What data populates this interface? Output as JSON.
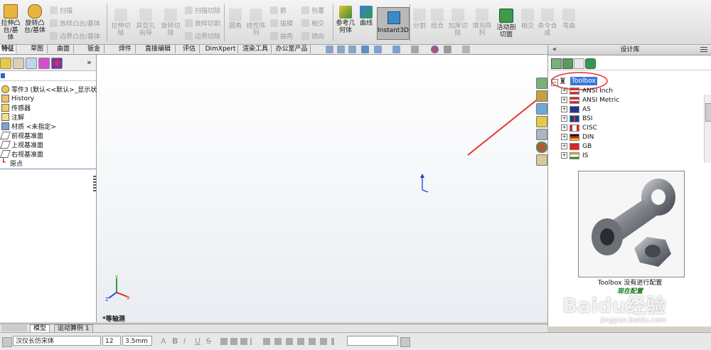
{
  "ribbon": {
    "big_buttons": [
      {
        "label1": "拉伸凸",
        "label2": "台/基体"
      },
      {
        "label1": "旋转凸",
        "label2": "台/基体"
      }
    ],
    "small_group1": [
      "扫描",
      "放样凸台/基体",
      "边界凸台/基体"
    ],
    "cut_buttons": [
      {
        "label1": "拉伸切",
        "label2": "除"
      },
      {
        "label1": "异型孔",
        "label2": "向导"
      },
      {
        "label1": "旋转切",
        "label2": "除"
      }
    ],
    "small_group2": [
      "扫描切除",
      "放样切割",
      "边界切除"
    ],
    "feature_buttons": [
      {
        "label1": "圆角",
        "label2": ""
      },
      {
        "label1": "线性阵",
        "label2": "列"
      }
    ],
    "small_group3": [
      "筋",
      "拔模",
      "抽壳"
    ],
    "small_group4": [
      "包覆",
      "相交",
      "镜向"
    ],
    "ref_geometry": {
      "label1": "参考几",
      "label2": "何体"
    },
    "curves": {
      "label1": "曲线",
      "label2": ""
    },
    "instant3d": "Instant3D",
    "right_buttons": [
      {
        "label1": "分割",
        "label2": ""
      },
      {
        "label1": "组合",
        "label2": ""
      },
      {
        "label1": "加厚切",
        "label2": "除"
      },
      {
        "label1": "填充阵",
        "label2": "列"
      },
      {
        "label1": "活动剖",
        "label2": "切面"
      },
      {
        "label1": "相交",
        "label2": ""
      },
      {
        "label1": "命令合",
        "label2": "成"
      },
      {
        "label1": "弯曲",
        "label2": ""
      }
    ]
  },
  "tabs": [
    "特征",
    "草图",
    "曲面",
    "钣金",
    "焊件",
    "直接编辑",
    "评估",
    "DimXpert",
    "渲染工具",
    "办公室产品"
  ],
  "feature_tree": {
    "collapse_label": "»",
    "root": "零件3 (默认<<默认>_显示状态",
    "items": [
      "History",
      "传感器",
      "注解",
      "材质 <未指定>",
      "前视基准面",
      "上视基准面",
      "右视基准面",
      "原点"
    ]
  },
  "viewport": {
    "view_label": "*等轴测",
    "axis_x": "X",
    "axis_y": "Y",
    "axis_z": "Z"
  },
  "design_library": {
    "title": "设计库",
    "collapse_label": "«",
    "root": "Toolbox",
    "standards": [
      "ANSI Inch",
      "ANSI Metric",
      "AS",
      "BSI",
      "CISC",
      "DIN",
      "GB",
      "IS"
    ],
    "message": "Toolbox 没有进行配置",
    "configure_link": "现在配置"
  },
  "bottom_tabs": [
    "模型",
    "运动算例 1"
  ],
  "statusbar": {
    "font": "汉仪长仿宋体",
    "size": "12",
    "height": "3.5mm",
    "format_labels": [
      "A",
      "B",
      "I",
      "U",
      "S"
    ]
  },
  "watermark": {
    "text": "Baidu经验",
    "url_text": "jingyan.baidu.com"
  },
  "colors": {
    "accent_red": "#e8322d",
    "toolbox_highlight": "#3b78d8",
    "axis_blue": "#1a3fd6"
  }
}
